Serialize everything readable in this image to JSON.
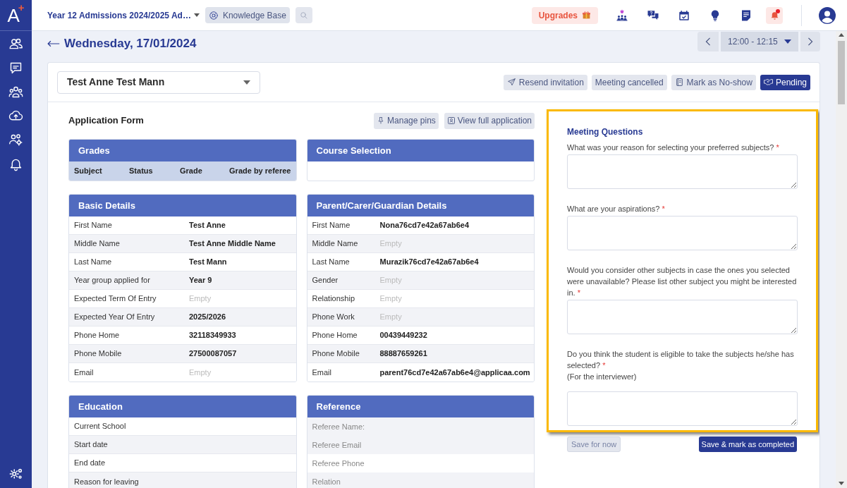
{
  "logo": {
    "letter": "A",
    "mark": "+"
  },
  "topbar": {
    "program": "Year 12 Admissions 2024/2025 Ad…",
    "knowledge_base": "Knowledge Base",
    "upgrades": "Upgrades",
    "notifications_unread": true
  },
  "page": {
    "title": "Wednesday, 17/01/2024",
    "time_slot": "12:00 - 12:15"
  },
  "applicant": "Test Anne Test Mann",
  "actions": [
    {
      "label": "Resend invitation",
      "kind": "send",
      "primary": false
    },
    {
      "label": "Meeting cancelled",
      "kind": "plain",
      "primary": false
    },
    {
      "label": "Mark as No-show",
      "kind": "noshow",
      "primary": false
    },
    {
      "label": "Pending",
      "kind": "status",
      "primary": true
    }
  ],
  "application_form": {
    "title": "Application Form",
    "buttons": [
      {
        "label": "Manage pins",
        "kind": "pins"
      },
      {
        "label": "View full application",
        "kind": "view"
      }
    ],
    "columns": [
      [
        {
          "title": "Grades",
          "kind": "table",
          "columns": [
            "Subject",
            "Status",
            "Grade",
            "Grade by referee"
          ]
        },
        {
          "title": "Basic Details",
          "kind": "fields",
          "rows": [
            {
              "label": "First Name",
              "value": "Test Anne",
              "empty": false
            },
            {
              "label": "Middle Name",
              "value": "Test Anne Middle Name",
              "empty": false
            },
            {
              "label": "Last Name",
              "value": "Test Mann",
              "empty": false
            },
            {
              "label": "Year group applied for",
              "value": "Year 9",
              "empty": false
            },
            {
              "label": "Expected Term Of Entry",
              "value": "Empty",
              "empty": true
            },
            {
              "label": "Expected Year Of Entry",
              "value": "2025/2026",
              "empty": false
            },
            {
              "label": "Phone Home",
              "value": "32118349933",
              "empty": false
            },
            {
              "label": "Phone Mobile",
              "value": "27500087057",
              "empty": false
            },
            {
              "label": "Email",
              "value": "Empty",
              "empty": true
            }
          ]
        },
        {
          "title": "Education",
          "kind": "fields",
          "rows": [
            {
              "label": "Current School"
            },
            {
              "label": "Start date"
            },
            {
              "label": "End date"
            },
            {
              "label": "Reason for leaving"
            }
          ]
        }
      ],
      [
        {
          "title": "Course Selection",
          "kind": "blank"
        },
        {
          "title": "Parent/Carer/Guardian Details",
          "kind": "fields",
          "rows": [
            {
              "label": "First Name",
              "value": "Nona76cd7e42a67ab6e4",
              "empty": false
            },
            {
              "label": "Middle Name",
              "value": "Empty",
              "empty": true
            },
            {
              "label": "Last Name",
              "value": "Murazik76cd7e42a67ab6e4",
              "empty": false
            },
            {
              "label": "Gender",
              "value": "Empty",
              "empty": true
            },
            {
              "label": "Relationship",
              "value": "Empty",
              "empty": true
            },
            {
              "label": "Phone Work",
              "value": "Empty",
              "empty": true
            },
            {
              "label": "Phone Home",
              "value": "00439449232",
              "empty": false
            },
            {
              "label": "Phone Mobile",
              "value": "88887659261",
              "empty": false
            },
            {
              "label": "Email",
              "value": "parent76cd7e42a67ab6e4@applicaa.com",
              "empty": false
            }
          ]
        },
        {
          "title": "Reference",
          "kind": "muted",
          "rows": [
            {
              "label": "Referee Name:"
            },
            {
              "label": "Referee Email"
            },
            {
              "label": "Referee Phone"
            },
            {
              "label": "Relation"
            }
          ]
        }
      ]
    ]
  },
  "meeting_questions": {
    "title": "Meeting Questions",
    "highlighted": true,
    "questions": [
      {
        "label": "What was your reason for selecting your preferred subjects?",
        "required_mark": "*"
      },
      {
        "label": "What are your aspirations?",
        "required_mark": "*"
      },
      {
        "label": "Would you consider other subjects in case the ones you selected were unavailable? Please list other subject you might be interested in.",
        "required_mark": "*"
      },
      {
        "label": "Do you think the student is eligible to take the subjects he/she has selected?",
        "required_mark": "*",
        "note": "(For the interviewer)"
      }
    ],
    "save_button": "Save for now",
    "complete_button": "Save & mark as completed"
  }
}
